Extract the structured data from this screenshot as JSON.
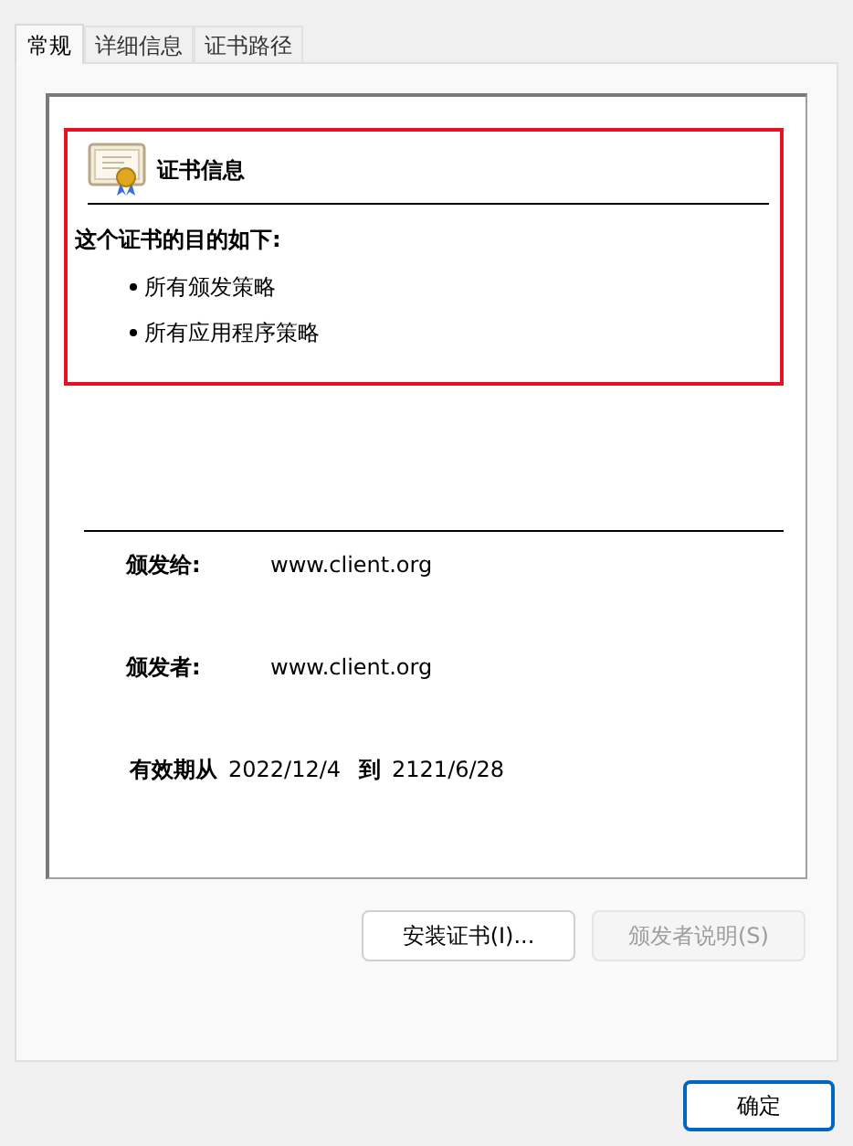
{
  "tabs": [
    {
      "label": "常规",
      "selected": true
    },
    {
      "label": "详细信息",
      "selected": false
    },
    {
      "label": "证书路径",
      "selected": false
    }
  ],
  "certificate_info": {
    "title": "证书信息",
    "purpose_heading": "这个证书的目的如下:",
    "purposes": [
      "所有颁发策略",
      "所有应用程序策略"
    ]
  },
  "fields": [
    {
      "label": "颁发给:",
      "value": "www.client.org"
    },
    {
      "label": "颁发者:",
      "value": "www.client.org"
    }
  ],
  "validity": {
    "label": "有效期从",
    "from": "2022/12/4",
    "to_label": "到",
    "to": "2121/6/28"
  },
  "buttons": [
    {
      "label": "安装证书(I)...",
      "disabled": false
    },
    {
      "label": "颁发者说明(S)",
      "disabled": true
    }
  ],
  "ok_button": {
    "label": "确定"
  }
}
